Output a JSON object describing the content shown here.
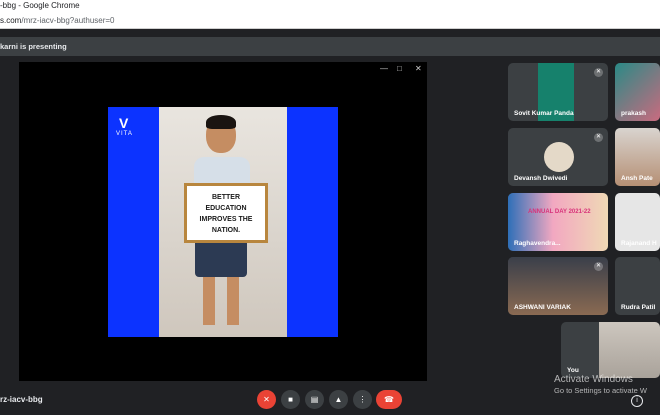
{
  "browser": {
    "title": "-bbg - Google Chrome",
    "url_host": "s.com",
    "url_path": "/mrz-iacv-bbg?authuser=0"
  },
  "meet": {
    "presenting_banner": "karni is presenting",
    "meeting_code": "rz-iacv-bbg",
    "window_controls": [
      "—",
      "□",
      "✕"
    ]
  },
  "slide": {
    "logo_text": "VITA",
    "sign_lines": [
      "BETTER",
      "EDUCATION",
      "IMPROVES THE",
      "NATION."
    ],
    "colors": {
      "background": "#0c33ff"
    }
  },
  "participants": [
    {
      "name": "Sovit Kumar Panda",
      "muted": true
    },
    {
      "name": "prakash",
      "muted": false
    },
    {
      "name": "Devansh Dwivedi",
      "muted": true
    },
    {
      "name": "Ansh Pate",
      "muted": false
    },
    {
      "name": "Raghavendra...",
      "muted": false,
      "overlay": "ANNUAL DAY 2021-22"
    },
    {
      "name": "Rajanand H",
      "muted": false
    },
    {
      "name": "ASHWANI VARIAK",
      "muted": true
    },
    {
      "name": "Rudra Patil",
      "muted": false
    },
    {
      "name": "You",
      "muted": false
    }
  ],
  "controls": {
    "mic_icon": "mic-off-icon",
    "camera_icon": "camera-icon",
    "captions_icon": "captions-icon",
    "present_icon": "present-screen-icon",
    "more_icon": "more-options-icon",
    "hangup_icon": "hang-up-icon",
    "colors": {
      "danger": "#ea4335",
      "surface": "#3c4043"
    }
  },
  "watermark": {
    "line1": "Activate Windows",
    "line2": "Go to Settings to activate W"
  }
}
